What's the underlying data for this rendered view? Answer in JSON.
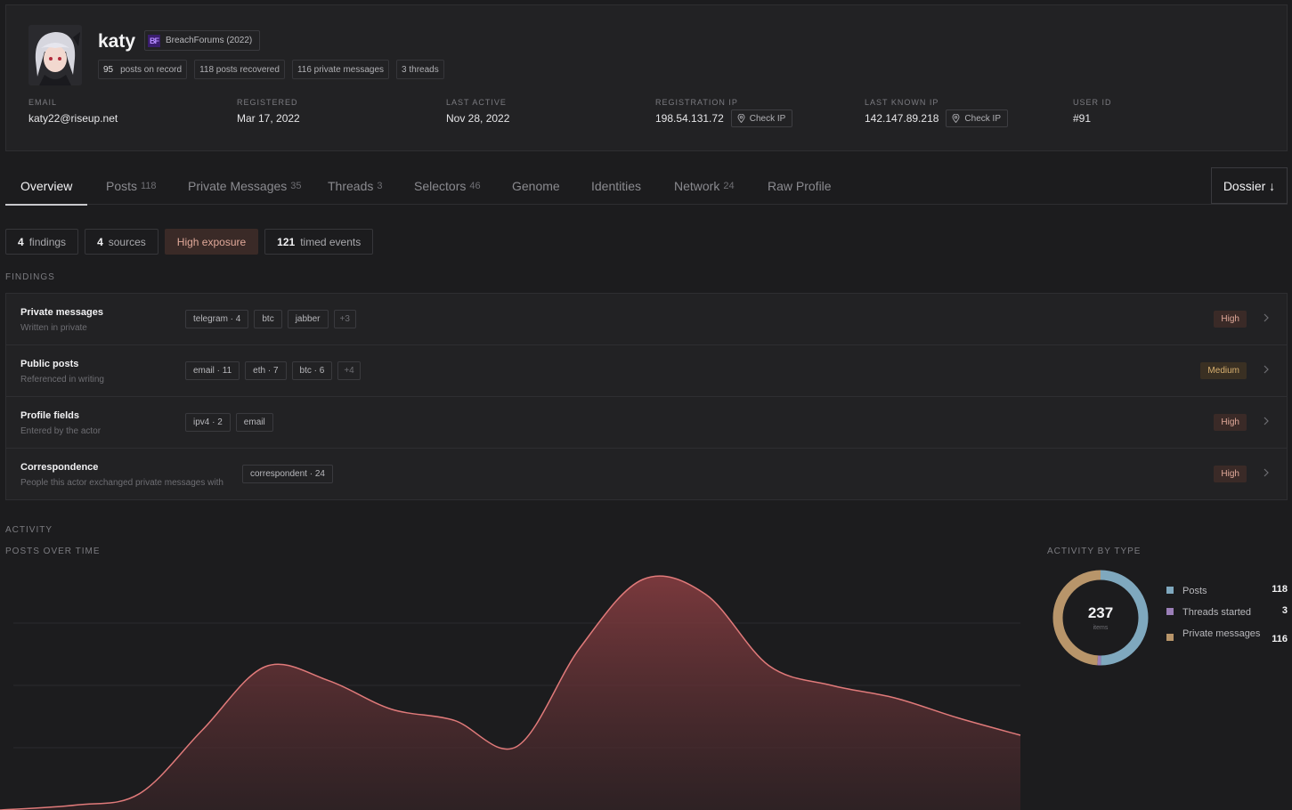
{
  "profile": {
    "username": "katy",
    "forum": {
      "logo": "BF",
      "name": "BreachForums (2022)"
    },
    "stats": [
      {
        "value": "95",
        "label": "posts on record"
      },
      {
        "value": "",
        "label": "118 posts recovered"
      },
      {
        "value": "",
        "label": "116 private messages"
      },
      {
        "value": "",
        "label": "3 threads"
      }
    ],
    "fields": {
      "email": {
        "label": "EMAIL",
        "value": "katy22@riseup.net"
      },
      "registered": {
        "label": "REGISTERED",
        "value": "Mar 17, 2022"
      },
      "last_active": {
        "label": "LAST ACTIVE",
        "value": "Nov 28, 2022"
      },
      "registration_ip": {
        "label": "REGISTRATION IP",
        "value": "198.54.131.72",
        "action": "Check IP"
      },
      "last_known_ip": {
        "label": "LAST KNOWN IP",
        "value": "142.147.89.218",
        "action": "Check IP"
      },
      "user_id": {
        "label": "USER ID",
        "value": "#91"
      }
    }
  },
  "tabs": [
    {
      "label": "Overview",
      "count": ""
    },
    {
      "label": "Posts",
      "count": "118"
    },
    {
      "label": "Private Messages",
      "count": "35"
    },
    {
      "label": "Threads",
      "count": "3"
    },
    {
      "label": "Selectors",
      "count": "46"
    },
    {
      "label": "Genome",
      "count": ""
    },
    {
      "label": "Identities",
      "count": ""
    },
    {
      "label": "Network",
      "count": "24"
    },
    {
      "label": "Raw Profile",
      "count": ""
    }
  ],
  "dossier_label": "Dossier ↓",
  "summary": {
    "findings": {
      "value": "4",
      "label": "findings"
    },
    "sources": {
      "value": "4",
      "label": "sources"
    },
    "exposure": "High exposure",
    "events": {
      "value": "121",
      "label": "timed events"
    }
  },
  "findings_label": "FINDINGS",
  "findings": [
    {
      "title": "Private messages",
      "subtitle": "Written in private",
      "tags": [
        "telegram · 4",
        "btc",
        "jabber"
      ],
      "more": "+3",
      "severity": "High"
    },
    {
      "title": "Public posts",
      "subtitle": "Referenced in writing",
      "tags": [
        "email · 11",
        "eth · 7",
        "btc · 6"
      ],
      "more": "+4",
      "severity": "Medium"
    },
    {
      "title": "Profile fields",
      "subtitle": "Entered by the actor",
      "tags": [
        "ipv4 · 2",
        "email"
      ],
      "more": "",
      "severity": "High"
    },
    {
      "title": "Correspondence",
      "subtitle": "People this actor exchanged private messages with",
      "tags": [
        "correspondent · 24"
      ],
      "more": "",
      "severity": "High"
    }
  ],
  "activity_label": "ACTIVITY",
  "posts_over_time_label": "POSTS OVER TIME",
  "activity_by_type_label": "ACTIVITY BY TYPE",
  "donut": {
    "total": "237",
    "caption": "items",
    "items": [
      {
        "label": "Posts",
        "value": 118,
        "color": "#7fa8be"
      },
      {
        "label": "Threads started",
        "value": 3,
        "color": "#9b7fb8"
      },
      {
        "label": "Private messages",
        "value": 116,
        "color": "#b8956a"
      }
    ]
  },
  "chart_data": {
    "type": "area",
    "title": "POSTS OVER TIME",
    "y": [
      0,
      0.4,
      1.3,
      6.4,
      11.5,
      10.4,
      8.1,
      7.2,
      5.1,
      13.0,
      18.5,
      17.3,
      11.6,
      10.0,
      9.0,
      7.4,
      6.0
    ],
    "ylim": [
      0,
      20
    ],
    "gridlines": [
      5,
      10,
      15
    ],
    "color": "#e07a7a",
    "grid": true
  }
}
